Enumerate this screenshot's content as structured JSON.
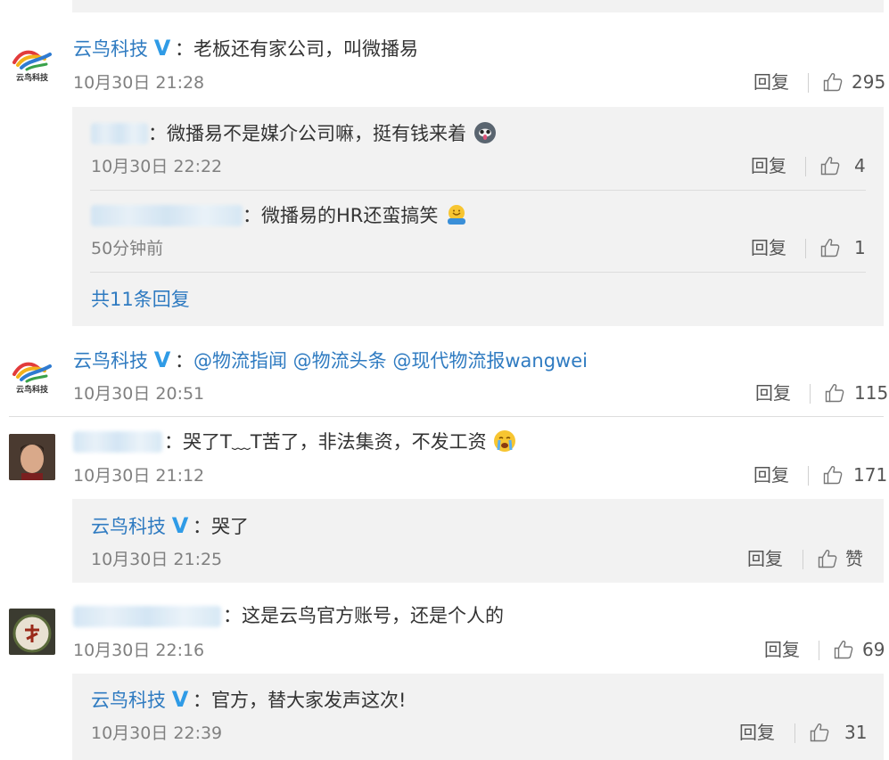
{
  "brand": {
    "name": "云鸟科技",
    "logo_text": "云鸟科技"
  },
  "comments": [
    {
      "author": "云鸟科技",
      "verified": "V",
      "text": "：老板还有家公司，叫微播易",
      "time": "10月30日 21:28",
      "reply_label": "回复",
      "likes": "295",
      "replies": [
        {
          "text": "：微播易不是媒介公司嘛，挺有钱来着",
          "time": "10月30日 22:22",
          "reply_label": "回复",
          "likes": "4"
        },
        {
          "text": "：微播易的HR还蛮搞笑",
          "time": "50分钟前",
          "reply_label": "回复",
          "likes": "1"
        }
      ],
      "more_replies": "共11条回复"
    },
    {
      "author": "云鸟科技",
      "verified": "V",
      "text_prefix": "：",
      "mentions": "@物流指闻 @物流头条 @现代物流报wangwei",
      "time": "10月30日 20:51",
      "reply_label": "回复",
      "likes": "115"
    },
    {
      "text": "：哭了T﹏T苦了，非法集资，不发工资",
      "time": "10月30日 21:12",
      "reply_label": "回复",
      "likes": "171",
      "replies": [
        {
          "author": "云鸟科技",
          "verified": "V",
          "text": "：哭了",
          "time": "10月30日 21:25",
          "reply_label": "回复",
          "likes": "赞"
        }
      ]
    },
    {
      "text": "：这是云鸟官方账号，还是个人的",
      "time": "10月30日 22:16",
      "reply_label": "回复",
      "likes": "69",
      "replies": [
        {
          "author": "云鸟科技",
          "verified": "V",
          "text": "：官方，替大家发声这次!",
          "time": "10月30日 22:39",
          "reply_label": "回复",
          "likes": "31"
        }
      ]
    }
  ],
  "colors": {
    "link": "#2f7bc1",
    "badge": "#2f9be6",
    "box": "#f2f2f2",
    "text": "#333333",
    "muted": "#808080"
  },
  "icons": [
    "thumbs-up-icon",
    "verified-v-icon",
    "husky-emoji-icon",
    "hug-emoji-icon",
    "crying-emoji-icon"
  ]
}
